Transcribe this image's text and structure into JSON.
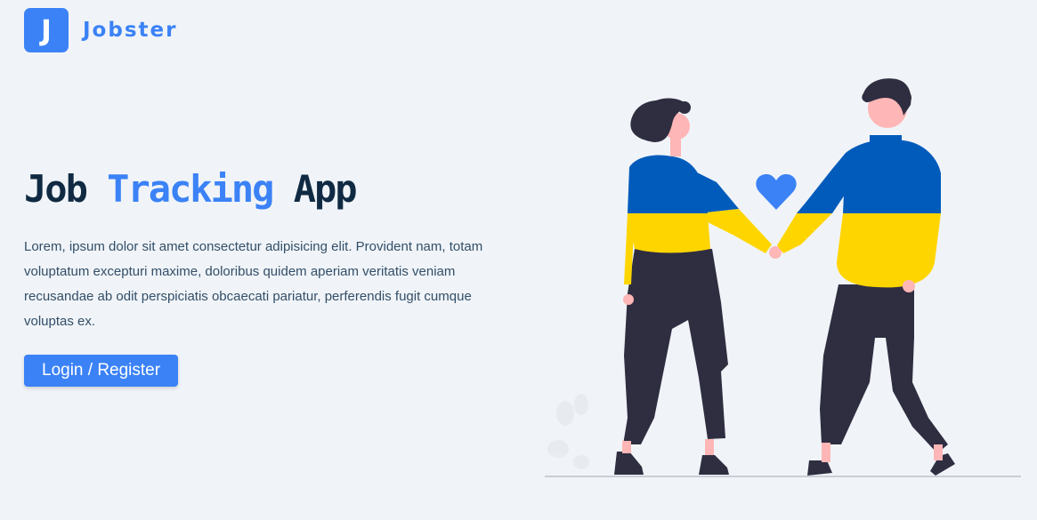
{
  "header": {
    "logo_letter": "J",
    "logo_text": "Jobster"
  },
  "hero": {
    "title_part1": "Job ",
    "title_accent": "Tracking",
    "title_part2": " App",
    "description": "Lorem, ipsum dolor sit amet consectetur adipisicing elit. Provident nam, totam voluptatum excepturi maxime, doloribus quidem aperiam veritatis veniam recusandae ab odit perspiciatis obcaecati pariatur, perferendis fugit cumque voluptas ex.",
    "button_label": "Login / Register"
  },
  "colors": {
    "background": "#f0f4f8",
    "primary": "#3b82f6",
    "heading": "#102a43",
    "text": "#334e68",
    "sweater_blue": "#005bbb",
    "sweater_yellow": "#ffd500",
    "pants": "#2f2e41",
    "skin": "#ffb6b6"
  },
  "illustration": {
    "heart_icon": "heart-icon",
    "figures": "couple-holding-hands"
  }
}
